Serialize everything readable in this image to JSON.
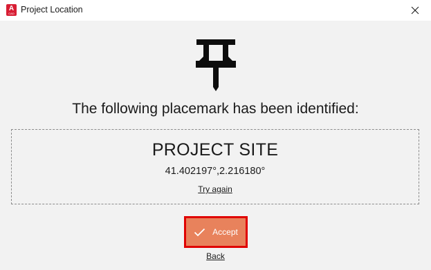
{
  "window": {
    "title": "Project Location",
    "app_icon_letter": "A",
    "app_icon_sub": "CAD"
  },
  "main": {
    "heading": "The following placemark has been identified:",
    "placemark": {
      "name": "PROJECT SITE",
      "coordinates": "41.402197°,2.216180°",
      "try_again_label": "Try again"
    },
    "accept_label": "Accept",
    "back_label": "Back"
  },
  "colors": {
    "accept_fill": "#e8825c",
    "accept_outline": "#e00000",
    "app_icon": "#d81e34"
  },
  "icons": [
    "app-icon",
    "close-icon",
    "pushpin-icon",
    "checkmark-icon"
  ]
}
